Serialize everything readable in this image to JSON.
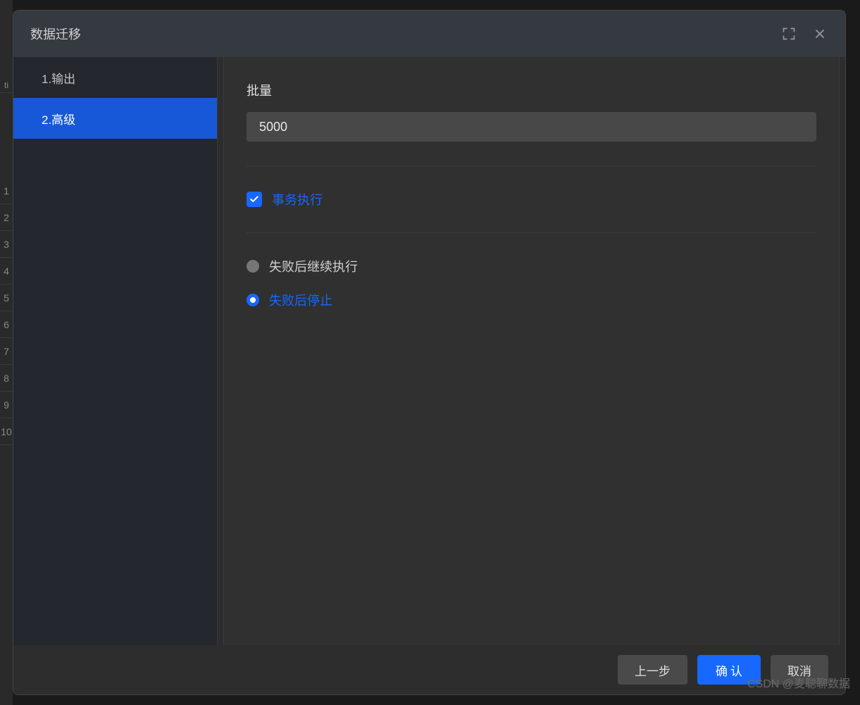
{
  "bg_rows": [
    "1",
    "2",
    "3",
    "4",
    "5",
    "6",
    "7",
    "8",
    "9",
    "10"
  ],
  "header": {
    "title": "数据迁移"
  },
  "sidebar": {
    "items": [
      {
        "label": "1.输出",
        "active": false
      },
      {
        "label": "2.高级",
        "active": true
      }
    ]
  },
  "content": {
    "batch_label": "批量",
    "batch_value": "5000",
    "transaction_label": "事务执行",
    "transaction_checked": true,
    "failure_options": [
      {
        "label": "失败后继续执行",
        "checked": false
      },
      {
        "label": "失败后停止",
        "checked": true
      }
    ]
  },
  "footer": {
    "prev_label": "上一步",
    "confirm_label": "确认",
    "cancel_label": "取消"
  },
  "watermark": "CSDN @麦聪聊数据"
}
